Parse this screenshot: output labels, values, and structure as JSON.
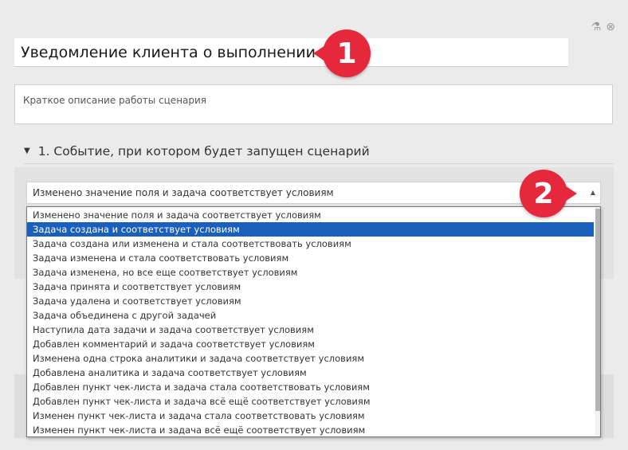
{
  "icons": {
    "flask": "flask-icon",
    "close": "close-circle-icon"
  },
  "title_input_value": "Уведомление клиента о выполнении",
  "description_placeholder": "Краткое описание работы сценария",
  "section": {
    "caret": "▼",
    "title": "1. Событие, при котором будет запущен сценарий"
  },
  "trigger_select": {
    "value": "Изменено значение поля и задача соответствует условиям",
    "arrow": "▲"
  },
  "dropdown_options": [
    "Изменено значение поля и задача соответствует условиям",
    "Задача создана и соответствует условиям",
    "Задача создана или изменена и стала соответствовать условиям",
    "Задача изменена и стала соответствовать условиям",
    "Задача изменена, но все еще соответствует условиям",
    "Задача принята и соответствует условиям",
    "Задача удалена и соответствует условиям",
    "Задача объединена с другой задачей",
    "Наступила дата задачи и задача соответствует условиям",
    "Добавлен комментарий и задача соответствует условиям",
    "Изменена одна строка аналитики и задача соответствует условиям",
    "Добавлена аналитика и задача соответствует условиям",
    "Добавлен пункт чек-листа и задача стала соответствовать условиям",
    "Добавлен пункт чек-листа и задача всё ещё соответствует условиям",
    "Изменен пункт чек-листа и задача стала соответствовать условиям",
    "Изменен пункт чек-листа и задача всё ещё соответствует условиям"
  ],
  "selected_option_index": 1,
  "badges": {
    "one": "1",
    "two": "2"
  },
  "colors": {
    "badge": "#e5283c",
    "selection": "#1b5fbd"
  }
}
